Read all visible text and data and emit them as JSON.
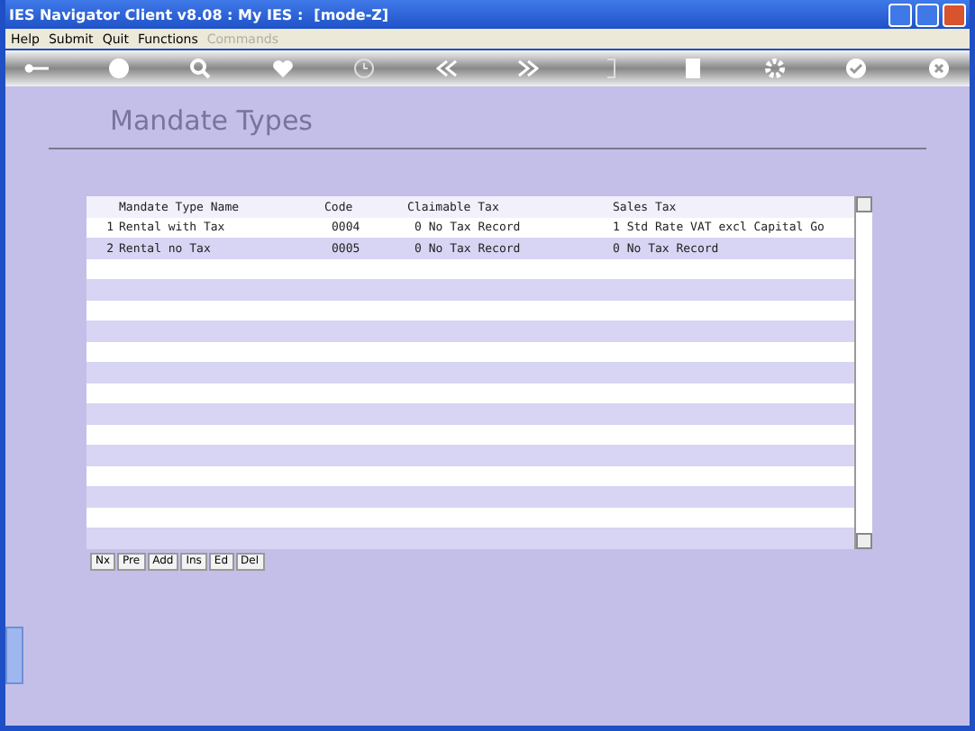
{
  "window": {
    "title": "IES Navigator Client v8.08 : My IES :",
    "mode": "[mode-Z]"
  },
  "menu": [
    {
      "label": "Help",
      "disabled": false
    },
    {
      "label": "Submit",
      "disabled": false
    },
    {
      "label": "Quit",
      "disabled": false
    },
    {
      "label": "Functions",
      "disabled": false
    },
    {
      "label": "Commands",
      "disabled": true
    }
  ],
  "page_title": "Mandate Types",
  "table": {
    "columns": [
      "Mandate Type Name",
      "Code",
      "Claimable Tax",
      "Sales Tax"
    ],
    "rows": [
      {
        "number": "1",
        "cells": [
          "Rental with Tax",
          "0004",
          "0 No Tax Record",
          "1 Std Rate VAT excl Capital Go"
        ]
      },
      {
        "number": "2",
        "cells": [
          "Rental no Tax",
          "0005",
          "0 No Tax Record",
          "0 No Tax Record"
        ]
      }
    ]
  },
  "actions": [
    "Nx",
    "Pre",
    "Add",
    "Ins",
    "Ed",
    "Del"
  ]
}
